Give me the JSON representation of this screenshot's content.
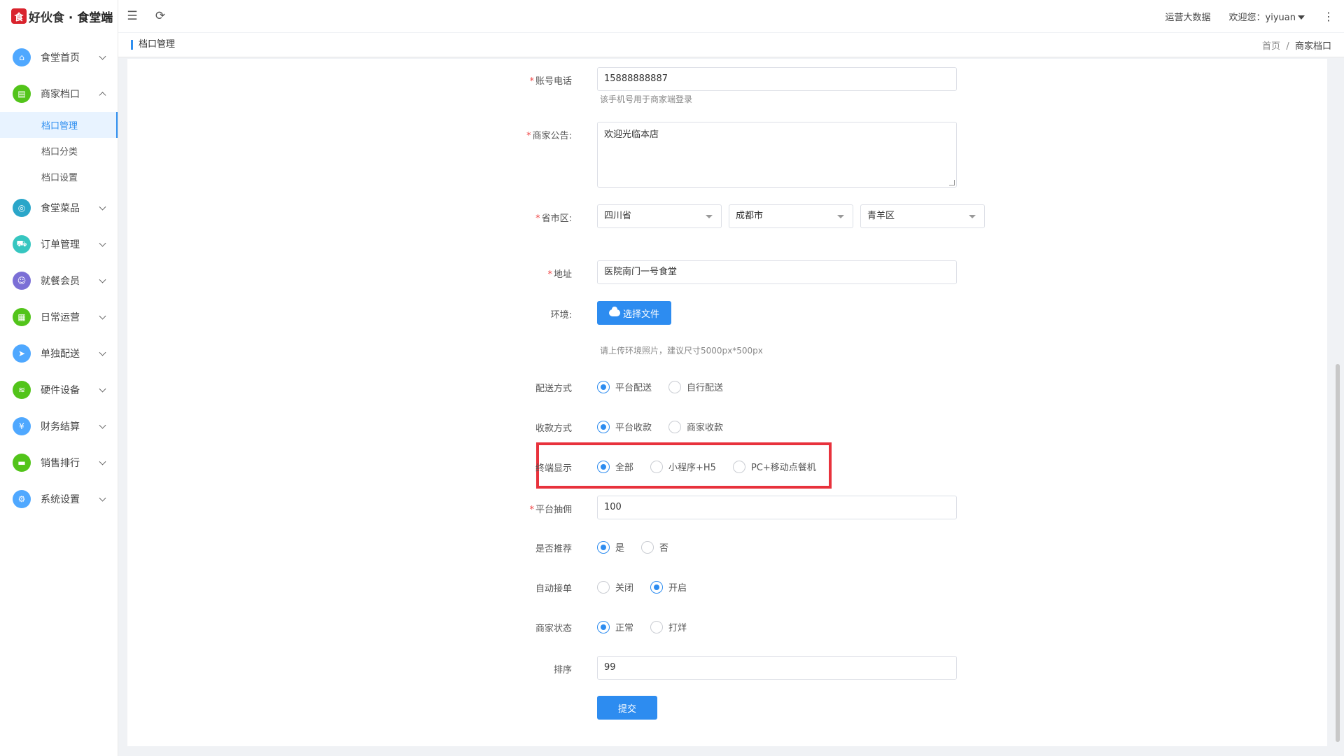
{
  "app": {
    "logo_mark": "食",
    "brand": "好伙食",
    "subtitle": "· 食堂端"
  },
  "header": {
    "big_data": "运营大数据",
    "welcome": "欢迎您：yiyuan"
  },
  "breadcrumb": {
    "title": "档口管理",
    "home": "首页",
    "sep": "/",
    "current": "商家档口"
  },
  "sidebar": {
    "items": [
      {
        "label": "食堂首页",
        "icon": "home-icon",
        "color": "#4fa8ff",
        "glyph": "⌂"
      },
      {
        "label": "商家档口",
        "icon": "store-icon",
        "color": "#52c41a",
        "glyph": "▤",
        "expanded": true
      },
      {
        "label": "食堂菜品",
        "icon": "dish-icon",
        "color": "#2aa6c9",
        "glyph": "◎"
      },
      {
        "label": "订单管理",
        "icon": "cart-icon",
        "color": "#36c6c0",
        "glyph": "⛟"
      },
      {
        "label": "就餐会员",
        "icon": "member-icon",
        "color": "#7b6fd6",
        "glyph": "☺"
      },
      {
        "label": "日常运营",
        "icon": "calendar-icon",
        "color": "#52c41a",
        "glyph": "▦"
      },
      {
        "label": "单独配送",
        "icon": "send-icon",
        "color": "#4fa8ff",
        "glyph": "➤"
      },
      {
        "label": "硬件设备",
        "icon": "wifi-icon",
        "color": "#52c41a",
        "glyph": "≋"
      },
      {
        "label": "财务结算",
        "icon": "finance-icon",
        "color": "#4fa8ff",
        "glyph": "¥"
      },
      {
        "label": "销售排行",
        "icon": "ranking-icon",
        "color": "#52c41a",
        "glyph": "▬"
      },
      {
        "label": "系统设置",
        "icon": "settings-icon",
        "color": "#4fa8ff",
        "glyph": "⚙"
      }
    ],
    "sub": [
      "档口管理",
      "档口分类",
      "档口设置"
    ]
  },
  "form": {
    "phone": {
      "label": "账号电话",
      "value": "15888888887",
      "hint": "该手机号用于商家端登录"
    },
    "notice": {
      "label": "商家公告:",
      "value": "欢迎光临本店"
    },
    "region": {
      "label": "省市区:",
      "province": "四川省",
      "city": "成都市",
      "district": "青羊区"
    },
    "address": {
      "label": "地址",
      "value": "医院南门一号食堂"
    },
    "env": {
      "label": "环境:",
      "button": "选择文件",
      "hint": "请上传环境照片，建议尺寸5000px*500px"
    },
    "delivery": {
      "label": "配送方式",
      "options": [
        "平台配送",
        "自行配送"
      ],
      "selected": 0
    },
    "payment": {
      "label": "收款方式",
      "options": [
        "平台收款",
        "商家收款"
      ],
      "selected": 0
    },
    "terminal": {
      "label": "终端显示",
      "options": [
        "全部",
        "小程序+H5",
        "PC+移动点餐机"
      ],
      "selected": 0
    },
    "commission": {
      "label": "平台抽佣",
      "value": "100"
    },
    "recommend": {
      "label": "是否推荐",
      "options": [
        "是",
        "否"
      ],
      "selected": 0
    },
    "auto_accept": {
      "label": "自动接单",
      "options": [
        "关闭",
        "开启"
      ],
      "selected": 1
    },
    "status": {
      "label": "商家状态",
      "options": [
        "正常",
        "打烊"
      ],
      "selected": 0
    },
    "sort": {
      "label": "排序",
      "value": "99"
    },
    "submit": "提交"
  }
}
